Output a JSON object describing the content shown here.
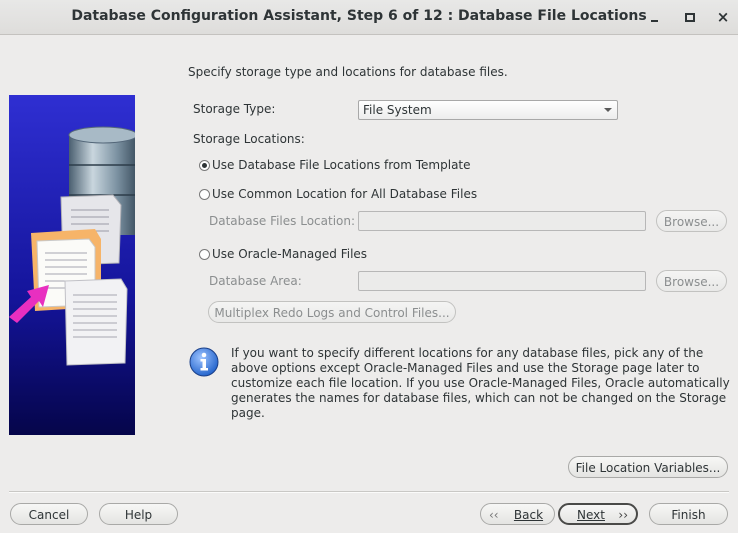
{
  "window": {
    "title": "Database Configuration Assistant, Step 6 of 12 : Database File Locations",
    "controls": {
      "minimize": "minimize",
      "maximize": "maximize",
      "close": "×"
    }
  },
  "main": {
    "intro": "Specify storage type and locations for database files.",
    "storage_type_label": "Storage Type:",
    "storage_type_value": "File System",
    "storage_locations_label": "Storage Locations:",
    "options": [
      {
        "label": "Use Database File Locations from Template",
        "selected": true
      },
      {
        "label": "Use Common Location for All Database Files",
        "selected": false
      },
      {
        "label": "Use Oracle-Managed Files",
        "selected": false
      }
    ],
    "db_files_location_label": "Database Files Location:",
    "db_files_location_value": "",
    "db_area_label": "Database Area:",
    "db_area_value": "",
    "browse_label": "Browse...",
    "multiplex_label": "Multiplex Redo Logs and Control Files...",
    "info_text": "If you want to specify different locations for any database files, pick any of the above options except Oracle-Managed Files and use the Storage page later to customize each file location. If you use Oracle-Managed Files, Oracle automatically generates the names for database files, which can not be changed on the Storage page.",
    "file_location_variables_label": "File Location Variables..."
  },
  "footer": {
    "cancel": "Cancel",
    "help": "Help",
    "back": "Back",
    "next": "Next",
    "finish": "Finish"
  },
  "icons": {
    "info": "info-icon",
    "back": "chevron-left-icon",
    "next": "chevron-right-icon"
  },
  "colors": {
    "sidebar_blue": "#1a1aa8",
    "info_blue": "#2f6fd6",
    "background": "#edeceb"
  }
}
